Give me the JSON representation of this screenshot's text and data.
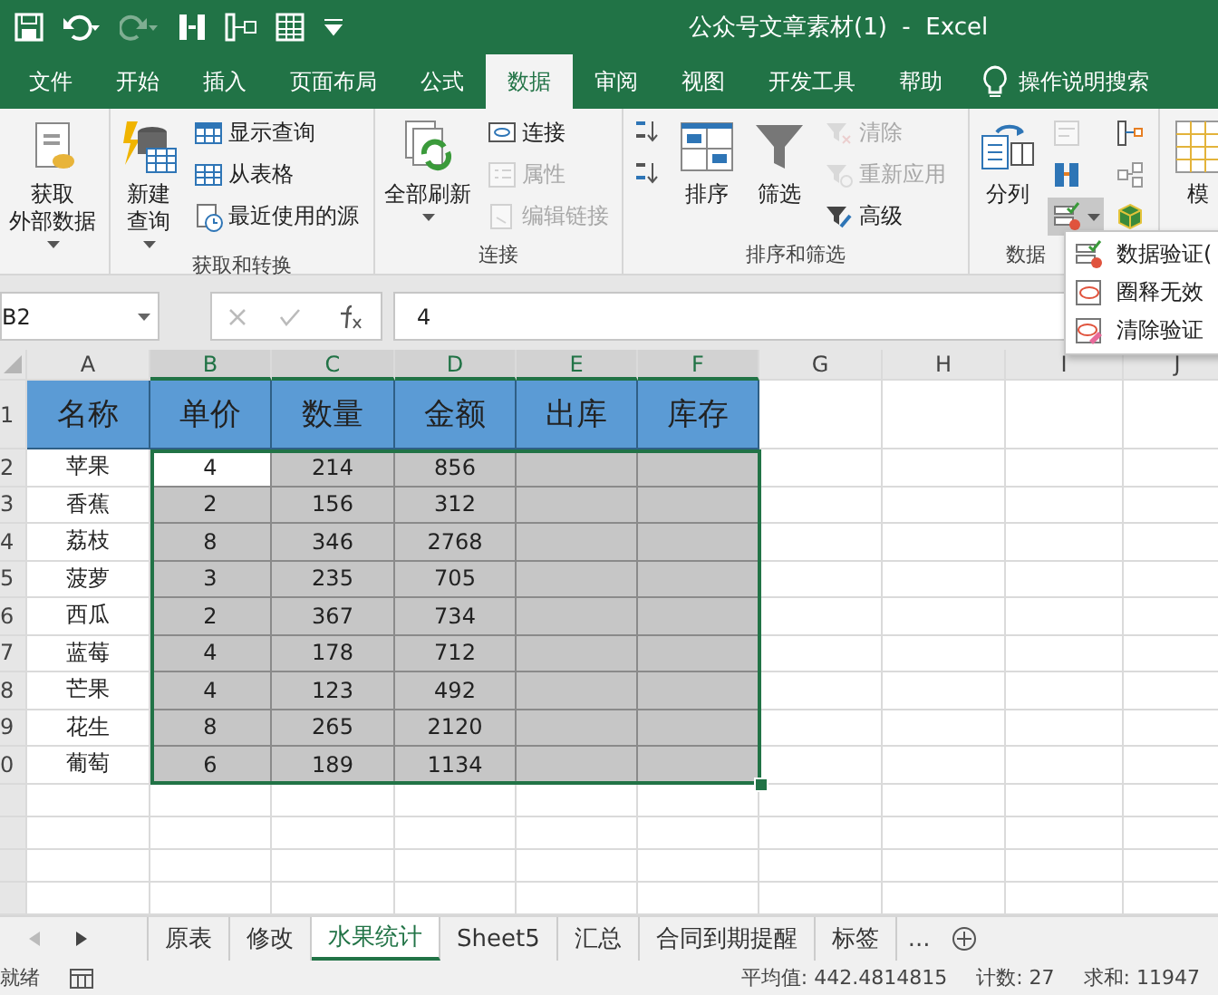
{
  "window": {
    "title": "公众号文章素材(1)  -  Excel"
  },
  "tabs": [
    {
      "label": "文件",
      "selected": false
    },
    {
      "label": "开始",
      "selected": false
    },
    {
      "label": "插入",
      "selected": false
    },
    {
      "label": "页面布局",
      "selected": false
    },
    {
      "label": "公式",
      "selected": false
    },
    {
      "label": "数据",
      "selected": true
    },
    {
      "label": "审阅",
      "selected": false
    },
    {
      "label": "视图",
      "selected": false
    },
    {
      "label": "开发工具",
      "selected": false
    },
    {
      "label": "帮助",
      "selected": false
    }
  ],
  "tell_me": "操作说明搜索",
  "ribbon": {
    "groups": [
      {
        "items": [
          {
            "kind": "large",
            "label_lines": [
              "获取",
              "外部数据"
            ],
            "dropdown": true
          }
        ]
      },
      {
        "label": "获取和转换",
        "items": [
          {
            "kind": "large",
            "label_lines": [
              "新建",
              "查询"
            ],
            "dropdown": true
          },
          {
            "kind": "stack",
            "items": [
              {
                "label": "显示查询",
                "disabled": false
              },
              {
                "label": "从表格",
                "disabled": false
              },
              {
                "label": "最近使用的源",
                "disabled": false
              }
            ]
          }
        ]
      },
      {
        "label": "连接",
        "items": [
          {
            "kind": "large",
            "label_lines": [
              "全部刷新"
            ],
            "dropdown": true
          },
          {
            "kind": "stack",
            "items": [
              {
                "label": "连接",
                "disabled": false
              },
              {
                "label": "属性",
                "disabled": true
              },
              {
                "label": "编辑链接",
                "disabled": true
              }
            ]
          }
        ]
      },
      {
        "label": "排序和筛选",
        "items": [
          {
            "kind": "stack",
            "items": [
              {
                "disabled": false
              },
              {
                "disabled": false
              }
            ]
          },
          {
            "kind": "large",
            "label_lines": [
              "排序"
            ],
            "dropdown": false
          },
          {
            "kind": "large",
            "label_lines": [
              "筛选"
            ],
            "dropdown": false
          },
          {
            "kind": "stack",
            "items": [
              {
                "label": "清除",
                "disabled": true
              },
              {
                "label": "重新应用",
                "disabled": true
              },
              {
                "label": "高级",
                "disabled": false
              }
            ]
          }
        ]
      },
      {
        "label": "数据",
        "items": [
          {
            "kind": "large",
            "label_lines": [
              "分列"
            ],
            "dropdown": false
          },
          {
            "kind": "stack",
            "items": [
              {
                "disabled": true,
                "pressed": false
              },
              {
                "disabled": false,
                "pressed": false
              },
              {
                "disabled": false,
                "pressed": true
              }
            ]
          },
          {
            "kind": "stack",
            "items": [
              {
                "disabled": false,
                "pressed": false
              },
              {
                "disabled": false,
                "pressed": false
              },
              {
                "disabled": false,
                "pressed": false
              }
            ]
          }
        ]
      },
      {
        "items": [
          {
            "kind": "large",
            "label_lines": [
              "模"
            ],
            "dropdown": false
          }
        ]
      }
    ]
  },
  "dropdown_menu": {
    "items": [
      {
        "label": "数据验证("
      },
      {
        "label": "圈释无效"
      },
      {
        "label": "清除验证"
      }
    ]
  },
  "formula_bar": {
    "name_box": "B2",
    "value": "4"
  },
  "sheet": {
    "columns": [
      {
        "label": "A",
        "selected": false
      },
      {
        "label": "B",
        "selected": true
      },
      {
        "label": "C",
        "selected": true
      },
      {
        "label": "D",
        "selected": true
      },
      {
        "label": "E",
        "selected": true
      },
      {
        "label": "F",
        "selected": true
      },
      {
        "label": "G",
        "selected": false
      },
      {
        "label": "H",
        "selected": false
      },
      {
        "label": "I",
        "selected": false
      },
      {
        "label": "J",
        "selected": false
      }
    ],
    "rows": [
      {
        "label": "1",
        "kind": "header",
        "cells": [
          {
            "text": "名称",
            "selected": false
          },
          {
            "text": "单价",
            "selected": false
          },
          {
            "text": "数量",
            "selected": false
          },
          {
            "text": "金额",
            "selected": false
          },
          {
            "text": "出库",
            "selected": false
          },
          {
            "text": "库存",
            "selected": false
          }
        ]
      },
      {
        "label": "2",
        "kind": "data",
        "cells": [
          {
            "text": "苹果",
            "selected": false
          },
          {
            "text": "4",
            "selected": true,
            "active": true
          },
          {
            "text": "214",
            "selected": true
          },
          {
            "text": "856",
            "selected": true
          },
          {
            "selected": true
          },
          {
            "selected": true
          }
        ]
      },
      {
        "label": "3",
        "kind": "data",
        "cells": [
          {
            "text": "香蕉",
            "selected": false
          },
          {
            "text": "2",
            "selected": true
          },
          {
            "text": "156",
            "selected": true
          },
          {
            "text": "312",
            "selected": true
          },
          {
            "selected": true
          },
          {
            "selected": true
          }
        ]
      },
      {
        "label": "4",
        "kind": "data",
        "cells": [
          {
            "text": "荔枝",
            "selected": false
          },
          {
            "text": "8",
            "selected": true
          },
          {
            "text": "346",
            "selected": true
          },
          {
            "text": "2768",
            "selected": true
          },
          {
            "selected": true
          },
          {
            "selected": true
          }
        ]
      },
      {
        "label": "5",
        "kind": "data",
        "cells": [
          {
            "text": "菠萝",
            "selected": false
          },
          {
            "text": "3",
            "selected": true
          },
          {
            "text": "235",
            "selected": true
          },
          {
            "text": "705",
            "selected": true
          },
          {
            "selected": true
          },
          {
            "selected": true
          }
        ]
      },
      {
        "label": "6",
        "kind": "data",
        "cells": [
          {
            "text": "西瓜",
            "selected": false
          },
          {
            "text": "2",
            "selected": true
          },
          {
            "text": "367",
            "selected": true
          },
          {
            "text": "734",
            "selected": true
          },
          {
            "selected": true
          },
          {
            "selected": true
          }
        ]
      },
      {
        "label": "7",
        "kind": "data",
        "cells": [
          {
            "text": "蓝莓",
            "selected": false
          },
          {
            "text": "4",
            "selected": true
          },
          {
            "text": "178",
            "selected": true
          },
          {
            "text": "712",
            "selected": true
          },
          {
            "selected": true
          },
          {
            "selected": true
          }
        ]
      },
      {
        "label": "8",
        "kind": "data",
        "cells": [
          {
            "text": "芒果",
            "selected": false
          },
          {
            "text": "4",
            "selected": true
          },
          {
            "text": "123",
            "selected": true
          },
          {
            "text": "492",
            "selected": true
          },
          {
            "selected": true
          },
          {
            "selected": true
          }
        ]
      },
      {
        "label": "9",
        "kind": "data",
        "cells": [
          {
            "text": "花生",
            "selected": false
          },
          {
            "text": "8",
            "selected": true
          },
          {
            "text": "265",
            "selected": true
          },
          {
            "text": "2120",
            "selected": true
          },
          {
            "selected": true
          },
          {
            "selected": true
          }
        ]
      },
      {
        "label": "0",
        "kind": "data",
        "cells": [
          {
            "text": "葡萄",
            "selected": false
          },
          {
            "text": "6",
            "selected": true
          },
          {
            "text": "189",
            "selected": true
          },
          {
            "text": "1134",
            "selected": true
          },
          {
            "selected": true
          },
          {
            "selected": true
          }
        ]
      }
    ]
  },
  "sheet_tabs": [
    {
      "label": "原表",
      "selected": false
    },
    {
      "label": "修改",
      "selected": false
    },
    {
      "label": "水果统计",
      "selected": true
    },
    {
      "label": "Sheet5",
      "selected": false
    },
    {
      "label": "汇总",
      "selected": false
    },
    {
      "label": "合同到期提醒",
      "selected": false
    },
    {
      "label": "标签",
      "selected": false
    }
  ],
  "sheet_tabs_overflow": "...",
  "status_bar": {
    "status": "就绪",
    "average": "平均值: 442.4814815",
    "count": "计数: 27",
    "sum": "求和: 11947"
  }
}
